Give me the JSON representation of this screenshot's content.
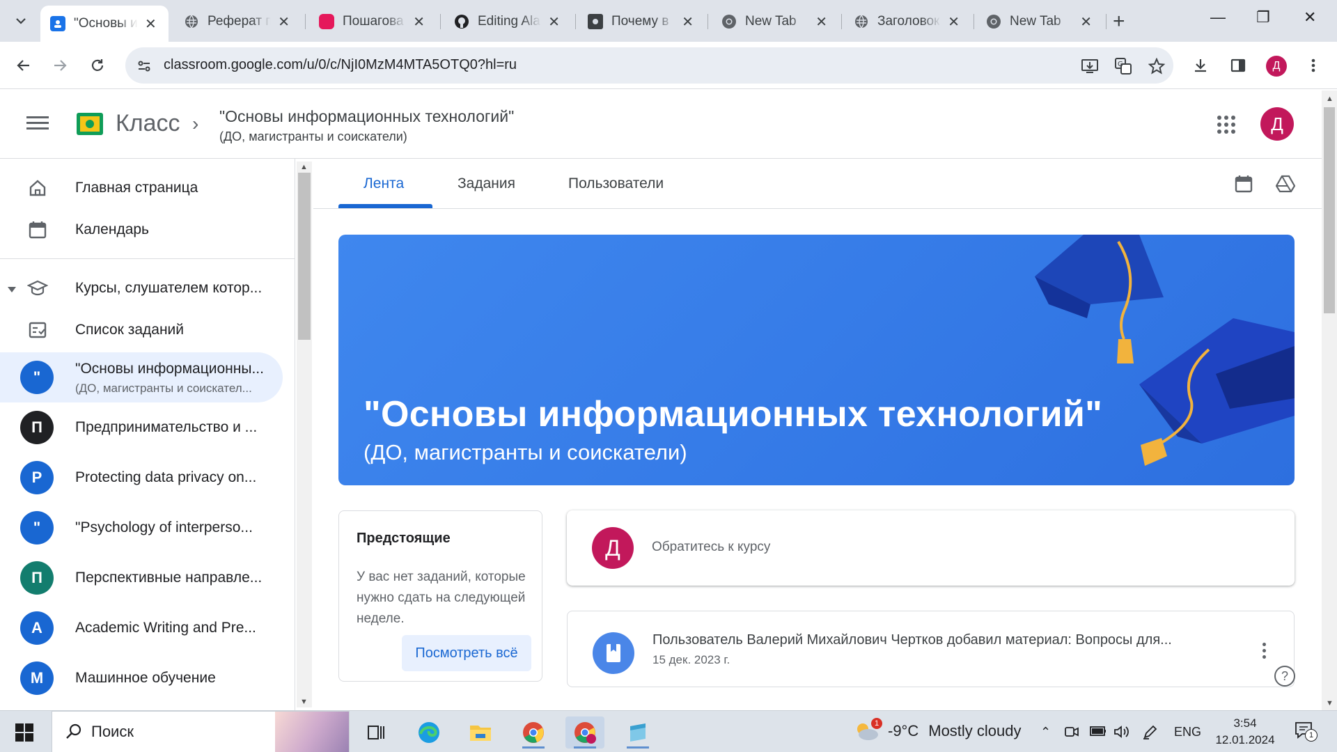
{
  "browser": {
    "tabs": [
      {
        "title": "\"Основы и",
        "active": true
      },
      {
        "title": "Реферат п"
      },
      {
        "title": "Пошагова"
      },
      {
        "title": "Editing Ala"
      },
      {
        "title": "Почему в"
      },
      {
        "title": "New Tab"
      },
      {
        "title": "Заголовок"
      },
      {
        "title": "New Tab"
      }
    ],
    "url": "classroom.google.com/u/0/c/NjI0MzM4MTA5OTQ0?hl=ru",
    "profile_initial": "Д"
  },
  "header": {
    "app_name": "Класс",
    "course_title": "\"Основы информационных технологий\"",
    "course_subtitle": "(ДО, магистранты и соискатели)",
    "avatar_initial": "Д"
  },
  "sidebar": {
    "home": "Главная страница",
    "calendar": "Календарь",
    "enrolled": "Курсы, слушателем котор...",
    "todo": "Список заданий",
    "courses": [
      {
        "initial": "\"",
        "title": "\"Основы информационны...",
        "subtitle": "(ДО, магистранты и соискател...",
        "color": "#1967d2"
      },
      {
        "initial": "П",
        "title": "Предпринимательство и ...",
        "color": "#202124"
      },
      {
        "initial": "P",
        "title": "Protecting data privacy on...",
        "color": "#1967d2"
      },
      {
        "initial": "\"",
        "title": "\"Psychology of interperso...",
        "color": "#1967d2"
      },
      {
        "initial": "П",
        "title": "Перспективные направле...",
        "color": "#137d6e"
      },
      {
        "initial": "A",
        "title": "Academic Writing and Pre...",
        "color": "#1967d2"
      },
      {
        "initial": "М",
        "title": "Машинное обучение",
        "color": "#1967d2"
      }
    ]
  },
  "course_tabs": {
    "stream": "Лента",
    "classwork": "Задания",
    "people": "Пользователи"
  },
  "banner": {
    "title": "\"Основы информационных технологий\"",
    "subtitle": "(ДО, магистранты и соискатели)"
  },
  "upcoming": {
    "heading": "Предстоящие",
    "text": "У вас нет заданий, которые нужно сдать на следующей неделе.",
    "view_all": "Посмотреть всё"
  },
  "announce": {
    "avatar_initial": "Д",
    "placeholder": "Обратитесь к курсу"
  },
  "posts": [
    {
      "text": "Пользователь Валерий Михайлович Чертков добавил материал: Вопросы для...",
      "date": "15 дек. 2023 г."
    }
  ],
  "taskbar": {
    "search": "Поиск",
    "weather_badge": "1",
    "temperature": "-9°C",
    "weather": "Mostly cloudy",
    "language": "ENG",
    "time": "3:54",
    "date": "12.01.2024",
    "notifications": "1"
  }
}
